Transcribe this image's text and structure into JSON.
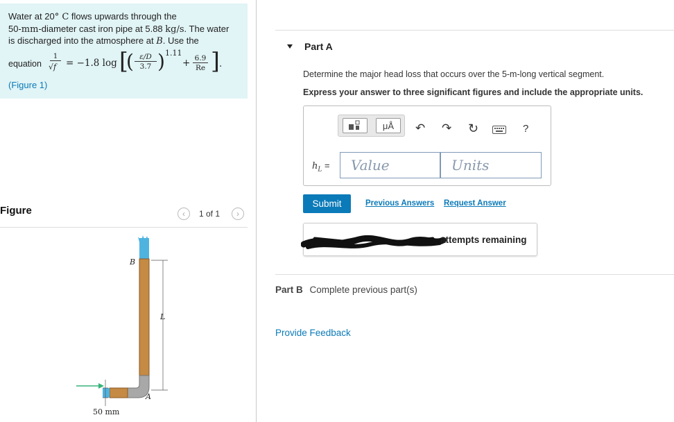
{
  "problem": {
    "line1_prefix": "Water at 20",
    "line1_unit": "° C",
    "line1_suffix": " flows upwards through the",
    "line2_prefix": "50-",
    "line2_unit": "mm",
    "line2_mid": "-diameter cast iron pipe at 5.88 ",
    "line2_rate": "kg/s",
    "line2_suffix": ". The water",
    "line3_prefix": "is discharged into the atmosphere at ",
    "line3_point": "B",
    "line3_suffix": ". Use the",
    "equation_word": "equation",
    "eq_lhs_num": "1",
    "eq_lhs_den": "√f",
    "eq_coef": "= −1.8 log",
    "eq_rough_num": "ε/D",
    "eq_rough_den": "3.7",
    "eq_exponent": "1.11",
    "eq_plus": "+",
    "eq_re_num": "6.9",
    "eq_re_den": "Re",
    "eq_end": ".",
    "figure_link": "Figure 1",
    "figure_link_open": "(",
    "figure_link_close": ")"
  },
  "figure": {
    "title": "Figure",
    "pager_text": "1 of 1",
    "prev_icon": "chevron-left-icon",
    "next_icon": "chevron-right-icon",
    "labels": {
      "B": "B",
      "L": "L",
      "A": "A",
      "diameter": "50 mm"
    },
    "colors": {
      "pipe": "#c58a43",
      "bend": "#a8a8a8",
      "water": "#4fb3e0",
      "arrow": "#37b37a"
    }
  },
  "partA": {
    "label": "Part A",
    "question": "Determine the major head loss that occurs over the 5-m-long vertical segment.",
    "instruction": "Express your answer to three significant figures and include the appropriate units.",
    "toolbar": {
      "templates_icon": "templates-icon",
      "units_button": "μÅ",
      "undo_icon": "undo-icon",
      "redo_icon": "redo-icon",
      "reset_icon": "reset-icon",
      "keyboard_icon": "keyboard-icon",
      "help": "?"
    },
    "variable": "h",
    "variable_sub": "L",
    "equals": "=",
    "value_placeholder": "Value",
    "units_placeholder": "Units",
    "submit": "Submit",
    "previous_answers": "Previous Answers",
    "request_answer": "Request Answer",
    "attempts": "attempts remaining"
  },
  "partB": {
    "label": "Part B",
    "text": "Complete previous part(s)"
  },
  "feedback": "Provide Feedback",
  "colors": {
    "accent": "#0b7ab8",
    "problem_bg": "#e1f4f6"
  }
}
